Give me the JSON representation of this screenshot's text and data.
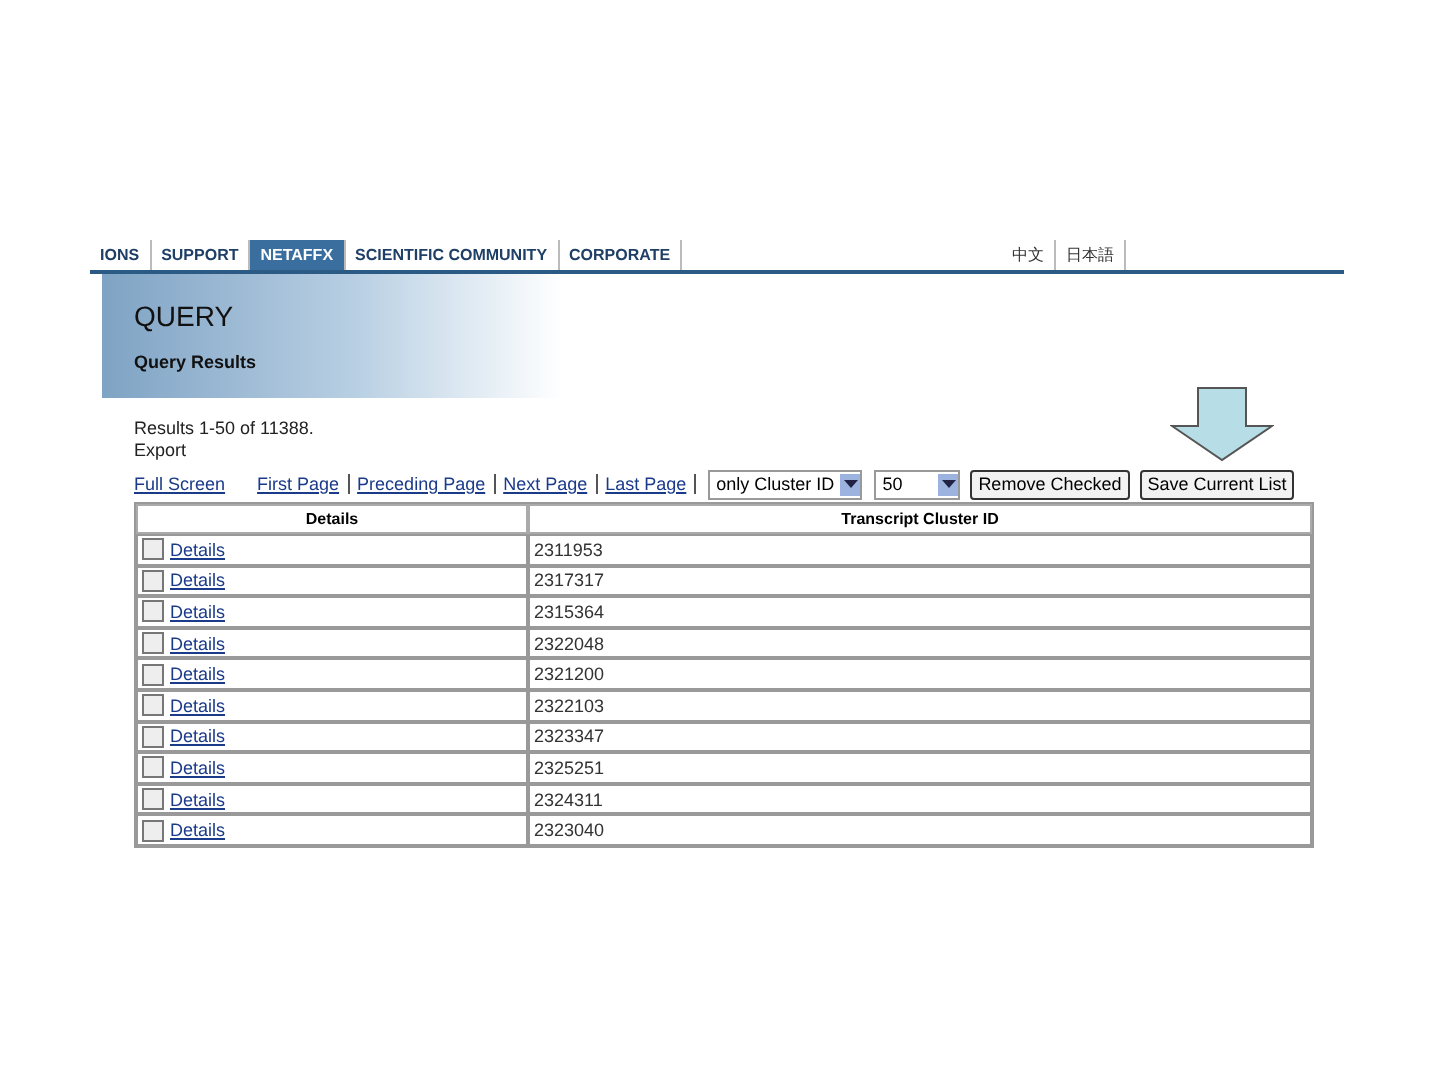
{
  "nav": {
    "items": [
      {
        "label": "IONS",
        "selected": false
      },
      {
        "label": "SUPPORT",
        "selected": false
      },
      {
        "label": "NETAFFX",
        "selected": true
      },
      {
        "label": "SCIENTIFIC COMMUNITY",
        "selected": false
      },
      {
        "label": "CORPORATE",
        "selected": false
      }
    ],
    "languages": [
      "中文",
      "日本語"
    ]
  },
  "banner": {
    "title": "QUERY",
    "subtitle": "Query Results"
  },
  "summary": "Results 1-50 of 11388.",
  "export": "Export",
  "pager": [
    "Full Screen",
    "First Page",
    "Preceding Page",
    "Next Page",
    "Last Page"
  ],
  "sort_select": "only Cluster ID",
  "page_size_select": "50",
  "buttons": [
    "Remove Checked",
    "Save Current List"
  ],
  "table": {
    "columns": [
      "Details",
      "Transcript Cluster ID"
    ],
    "rows": [
      {
        "checked": false,
        "link": "Details",
        "id": "2311953"
      },
      {
        "checked": false,
        "link": "Details",
        "id": "2317317"
      },
      {
        "checked": false,
        "link": "Details",
        "id": "2315364"
      },
      {
        "checked": false,
        "link": "Details",
        "id": "2322048"
      },
      {
        "checked": false,
        "link": "Details",
        "id": "2321200"
      },
      {
        "checked": false,
        "link": "Details",
        "id": "2322103"
      },
      {
        "checked": false,
        "link": "Details",
        "id": "2323347"
      },
      {
        "checked": false,
        "link": "Details",
        "id": "2325251"
      },
      {
        "checked": false,
        "link": "Details",
        "id": "2324311"
      },
      {
        "checked": false,
        "link": "Details",
        "id": "2323040"
      }
    ]
  }
}
